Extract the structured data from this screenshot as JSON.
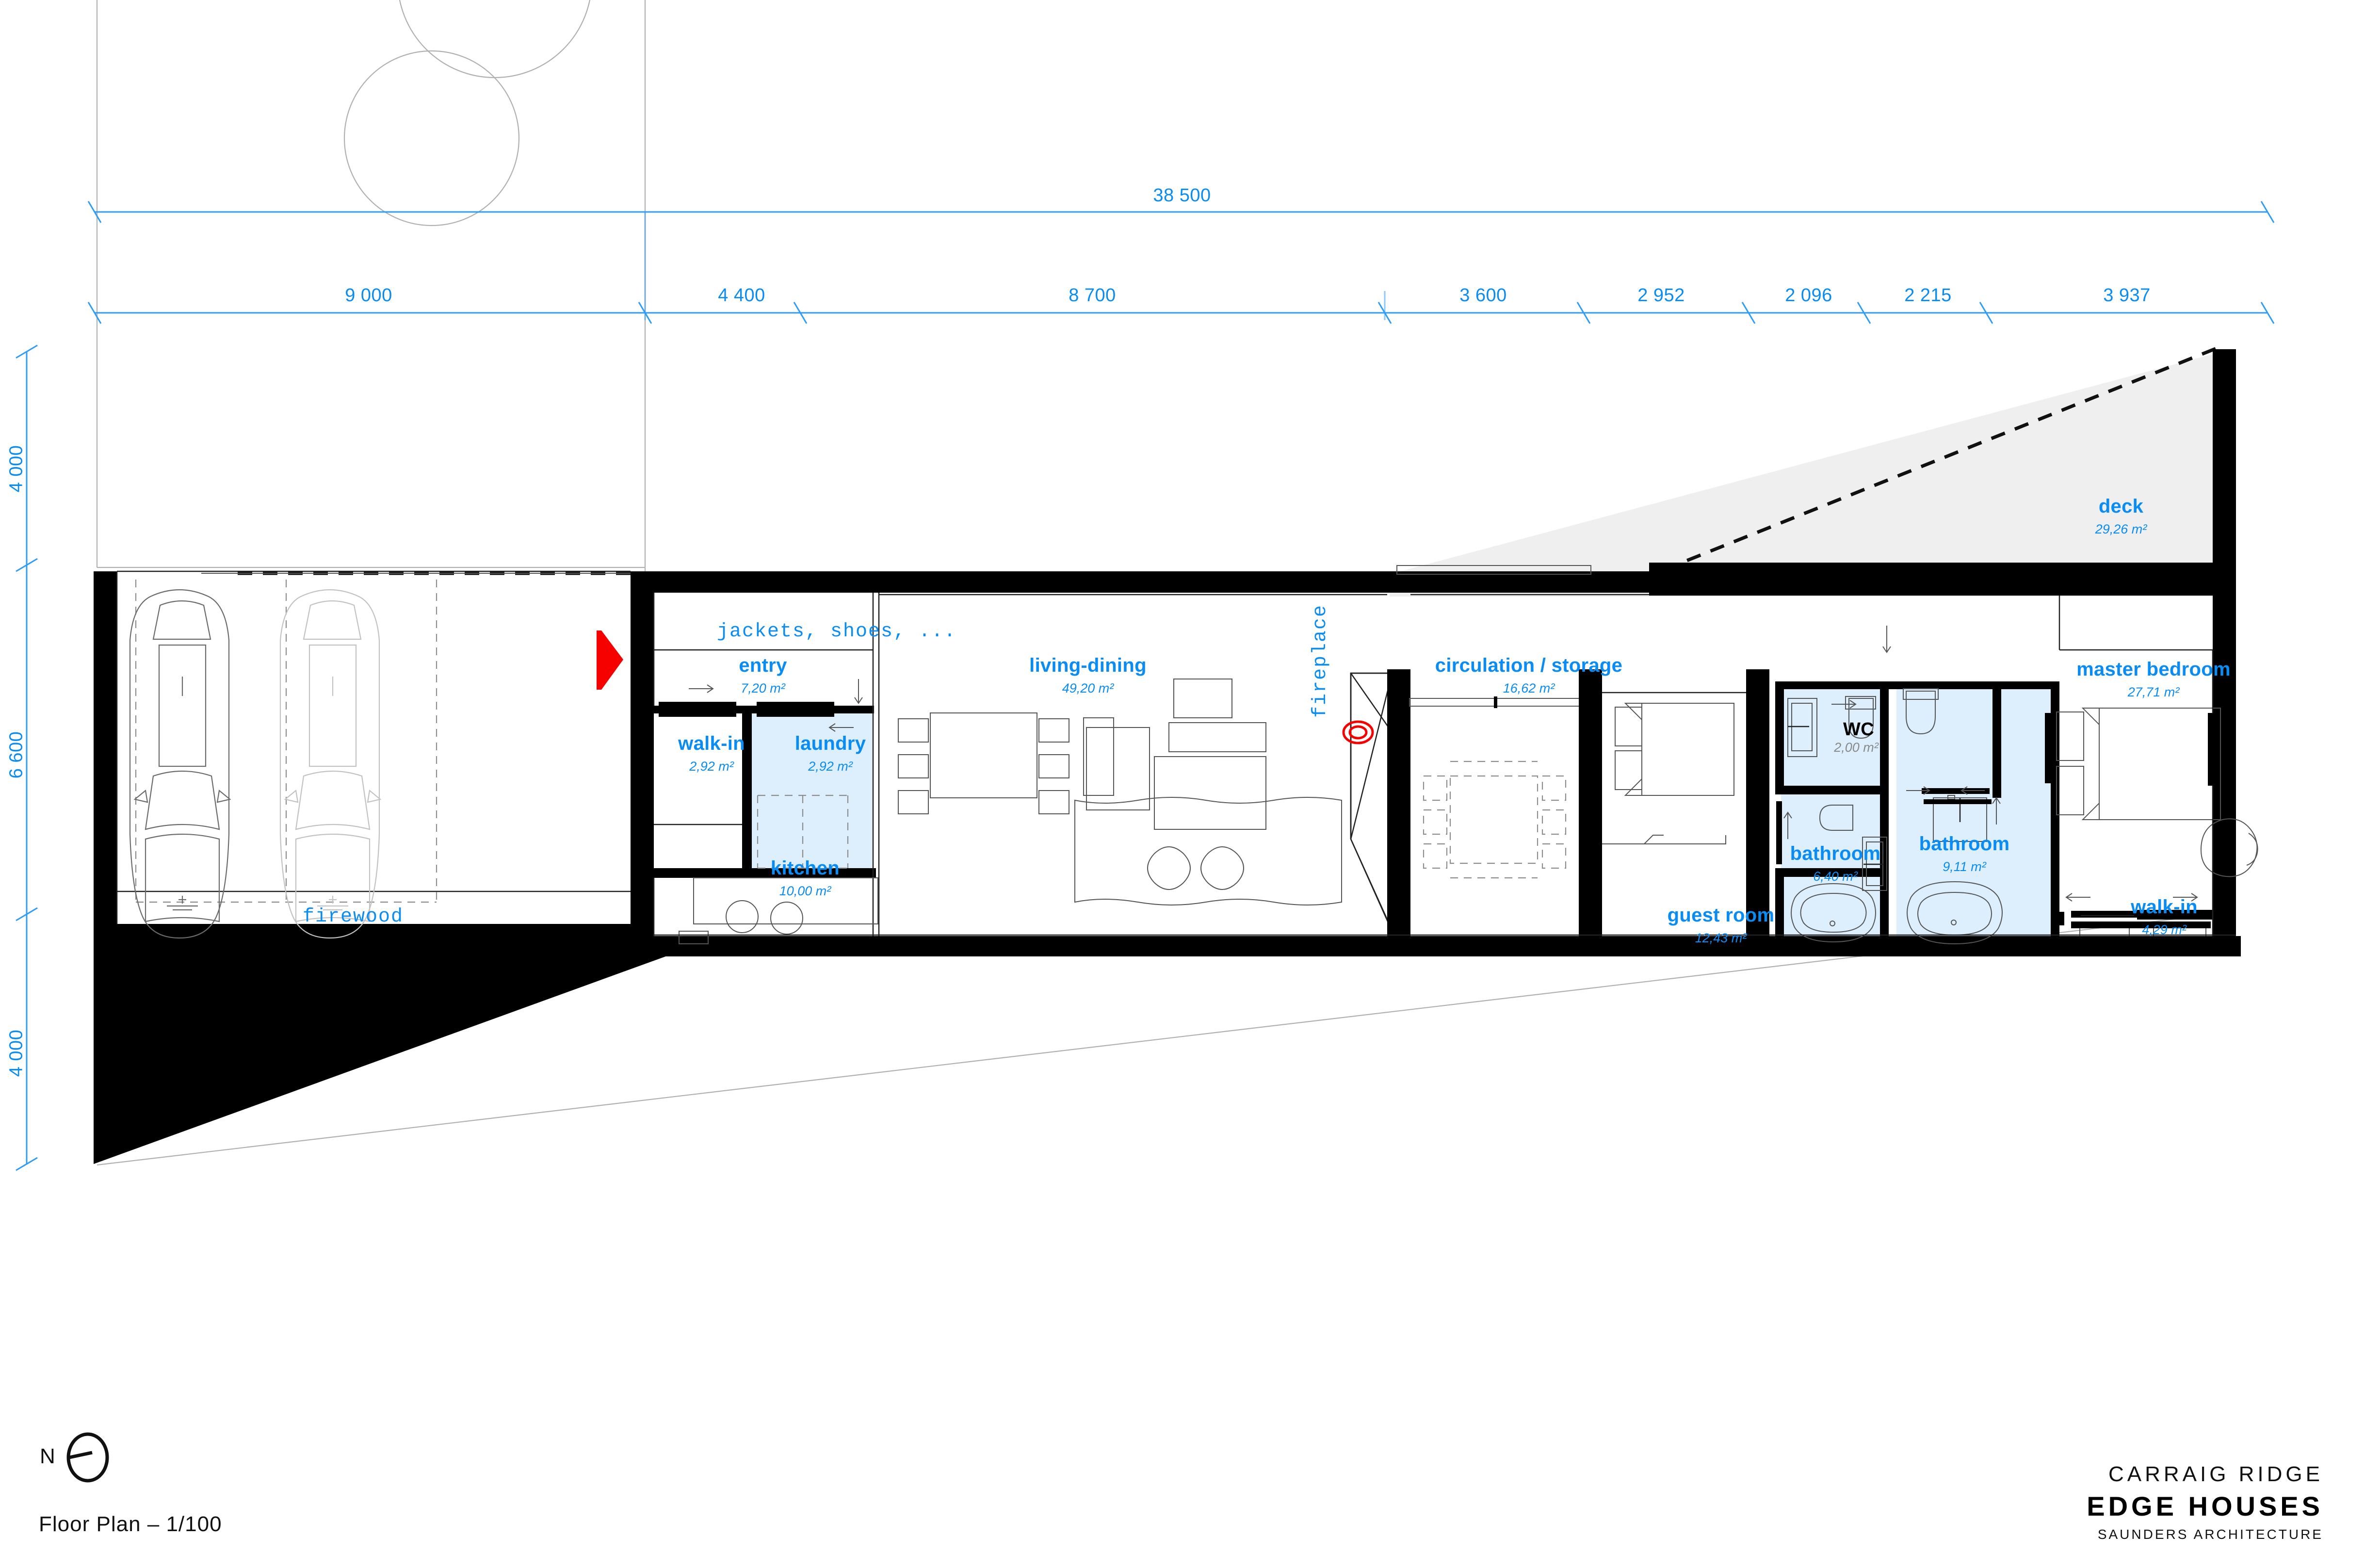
{
  "sheet": {
    "caption": "Floor Plan – 1/100",
    "north_label": "N"
  },
  "logo": {
    "line1": "CARRAIG RIDGE",
    "line2": "EDGE HOUSES",
    "line3": "SAUNDERS ARCHITECTURE"
  },
  "dimensions": {
    "overall_top": "38 500",
    "top_chain": [
      "9 000",
      "4 400",
      "8 700",
      "3 600",
      "2 952",
      "2 096",
      "2 215",
      "3 937"
    ],
    "left_chain": [
      "4 000",
      "6 600",
      "4 000"
    ]
  },
  "rooms": [
    {
      "id": "entry",
      "name": "entry",
      "area": "7,20 m²"
    },
    {
      "id": "walk-in-front",
      "name": "walk-in",
      "area": "2,92 m²"
    },
    {
      "id": "laundry",
      "name": "laundry",
      "area": "2,92 m²"
    },
    {
      "id": "kitchen",
      "name": "kitchen",
      "area": "10,00 m²"
    },
    {
      "id": "living-dining",
      "name": "living-dining",
      "area": "49,20 m²"
    },
    {
      "id": "circulation",
      "name": "circulation / storage",
      "area": "16,62 m²"
    },
    {
      "id": "guest-room",
      "name": "guest room",
      "area": "12,43 m²"
    },
    {
      "id": "wc",
      "name": "WC",
      "area": "2,00 m²"
    },
    {
      "id": "bathroom-small",
      "name": "bathroom",
      "area": "6,40 m²"
    },
    {
      "id": "bathroom-master",
      "name": "bathroom",
      "area": "9,11 m²"
    },
    {
      "id": "master-bedroom",
      "name": "master bedroom",
      "area": "27,71 m²"
    },
    {
      "id": "walk-in-master",
      "name": "walk-in",
      "area": "4,29 m²"
    },
    {
      "id": "deck",
      "name": "deck",
      "area": "29,26 m²"
    }
  ],
  "annotations": {
    "jackets": "jackets, shoes, ...",
    "firewood": "firewood",
    "fireplace": "fireplace"
  },
  "colors": {
    "accent_blue": "#0a8cf5",
    "wet_room_fill": "#ddeefc",
    "deck_fill": "#efefef",
    "wall_black": "#000000",
    "red_marker": "#f60000",
    "grey_line": "#8a8a8a"
  }
}
